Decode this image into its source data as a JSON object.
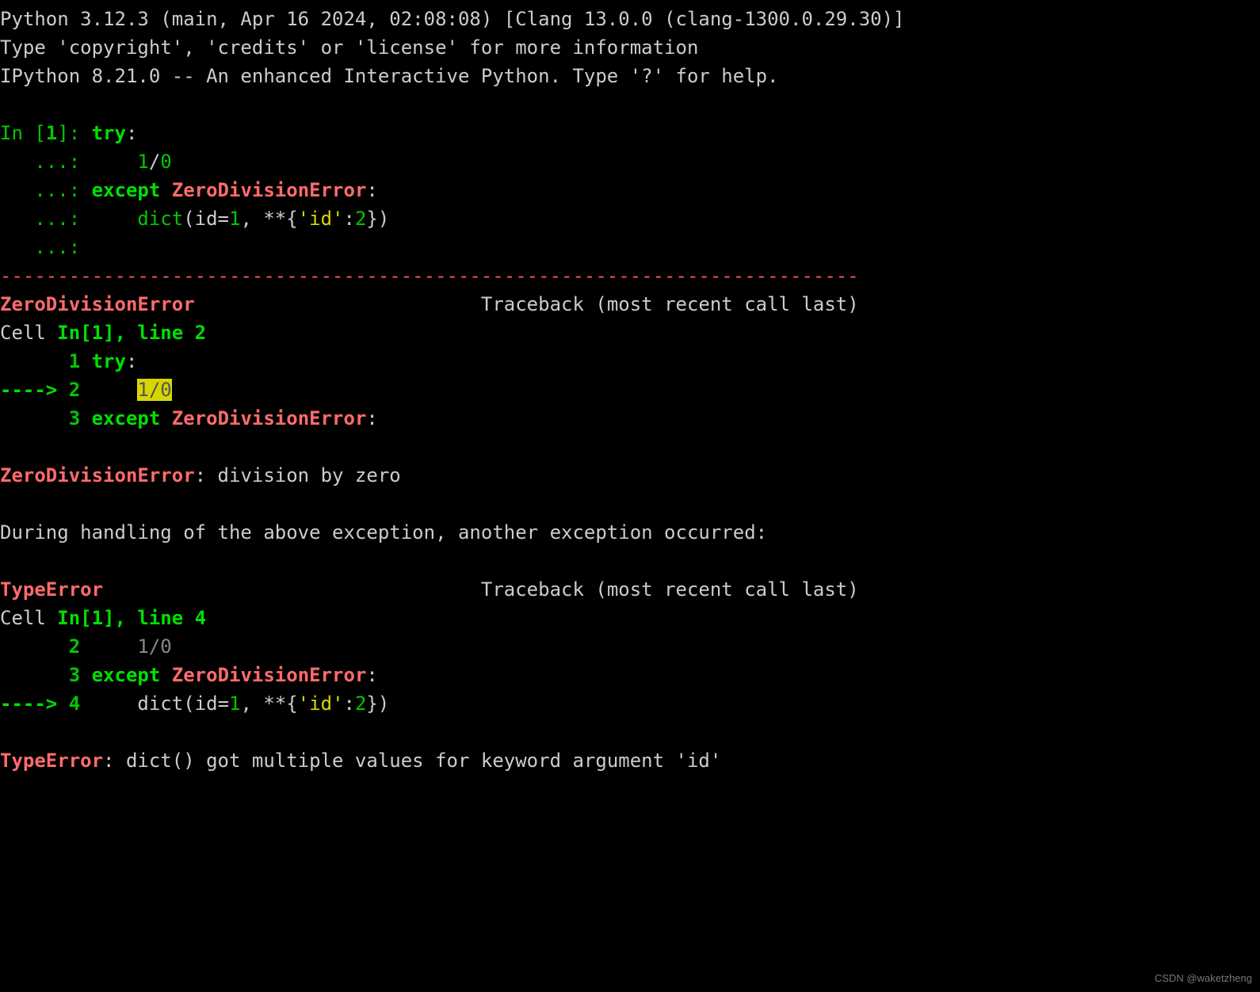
{
  "banner": {
    "line1": "Python 3.12.3 (main, Apr 16 2024, 02:08:08) [Clang 13.0.0 (clang-1300.0.29.30)]",
    "line2": "Type 'copyright', 'credits' or 'license' for more information",
    "line3": "IPython 8.21.0 -- An enhanced Interactive Python. Type '?' for help."
  },
  "input": {
    "prompt_in": "In [",
    "prompt_n": "1",
    "prompt_close": "]: ",
    "cont": "   ...: ",
    "l1_try": "try",
    "colon": ":",
    "l2_indent": "    ",
    "l2_num1": "1",
    "l2_slash": "/",
    "l2_num0": "0",
    "l3_except": "except",
    "l3_space": " ",
    "l3_err": "ZeroDivisionError",
    "l4_indent": "    ",
    "l4_dict": "dict",
    "l4_open": "(",
    "l4_id": "id",
    "l4_eq": "=",
    "l4_one": "1",
    "l4_comma": ", **{",
    "l4_key": "'id'",
    "l4_colon": ":",
    "l4_two": "2",
    "l4_close": "})"
  },
  "sep": "---------------------------------------------------------------------------",
  "tb1": {
    "err": "ZeroDivisionError",
    "pad": "                         ",
    "trace": "Traceback (most recent call last)",
    "cell_pre": "Cell ",
    "cell_in": "In[1]",
    "cell_line": ", line 2",
    "r1_pad": "      ",
    "r1_n": "1",
    "r1_sp": " ",
    "r1_try": "try",
    "r1_colon": ":",
    "arrow": "----> ",
    "r2_n": "2",
    "r2_pad": "     ",
    "r2_code": "1/0",
    "r3_pad": "      ",
    "r3_n": "3",
    "r3_sp": " ",
    "r3_except": "except",
    "r3_sp2": " ",
    "r3_err": "ZeroDivisionError",
    "r3_colon": ":",
    "msg_err": "ZeroDivisionError",
    "msg_txt": ": division by zero"
  },
  "chain": "During handling of the above exception, another exception occurred:",
  "tb2": {
    "err": "TypeError",
    "pad": "                                 ",
    "trace": "Traceback (most recent call last)",
    "cell_pre": "Cell ",
    "cell_in": "In[1]",
    "cell_line": ", line 4",
    "r2_pad": "      ",
    "r2_n": "2",
    "r2_sp": "     ",
    "r2_code": "1/0",
    "r3_pad": "      ",
    "r3_n": "3",
    "r3_sp": " ",
    "r3_except": "except",
    "r3_sp2": " ",
    "r3_err": "ZeroDivisionError",
    "r3_colon": ":",
    "arrow": "----> ",
    "r4_n": "4",
    "r4_pad": "     ",
    "r4_dict": "dict",
    "r4_open": "(",
    "r4_id": "id",
    "r4_eq": "=",
    "r4_one": "1",
    "r4_comma": ", **{",
    "r4_key": "'id'",
    "r4_colon": ":",
    "r4_two": "2",
    "r4_close": "})",
    "msg_err": "TypeError",
    "msg_txt": ": dict() got multiple values for keyword argument 'id'"
  },
  "watermark": "CSDN @waketzheng"
}
